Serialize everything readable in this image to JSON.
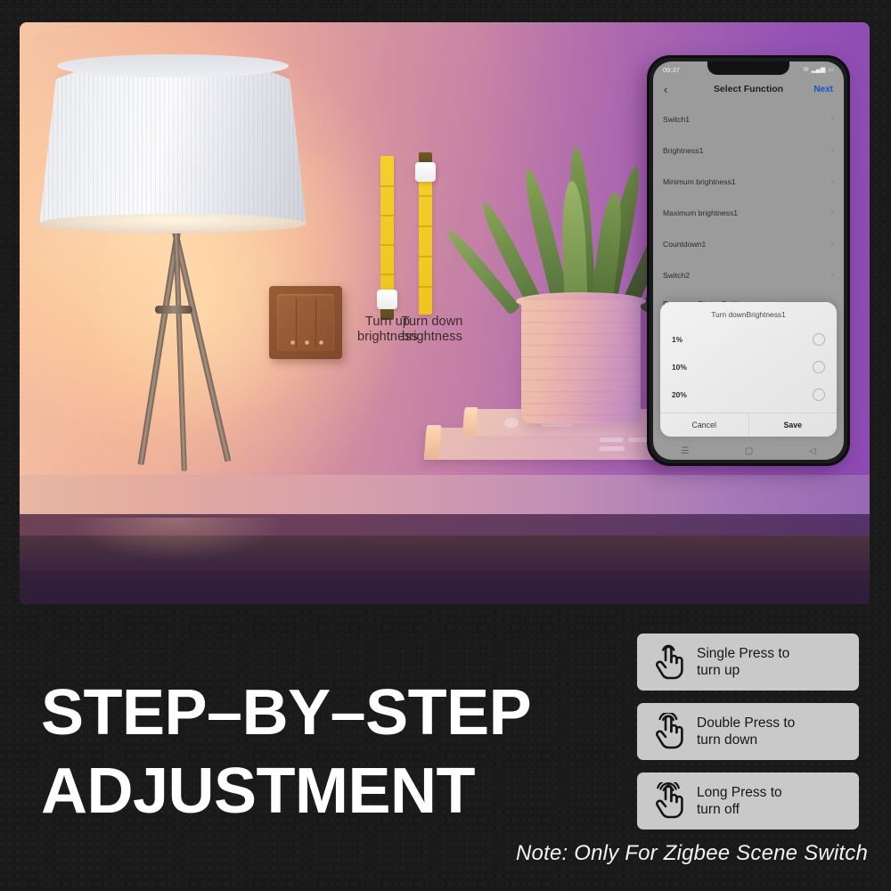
{
  "hero": {
    "slider_up": {
      "label": "Turn up\nbrightness"
    },
    "slider_down": {
      "label": "Turn down\nbrightness"
    }
  },
  "phone": {
    "status": {
      "time": "09:37",
      "mail_icon": "✉",
      "signal_icon": "▂▄▆",
      "battery_icon": "▭"
    },
    "navbar": {
      "back_icon": "‹",
      "title": "Select Function",
      "next_label": "Next"
    },
    "functions": [
      {
        "label": "Switch1",
        "chevron": "›"
      },
      {
        "label": "Brightness1",
        "chevron": "›"
      },
      {
        "label": "Minimum brightness1",
        "chevron": "›"
      },
      {
        "label": "Maximum brightness1",
        "chevron": "›"
      },
      {
        "label": "Countdown1",
        "chevron": "›"
      },
      {
        "label": "Switch2",
        "chevron": "›"
      },
      {
        "label": "Power-on Status Setting",
        "chevron": "›"
      }
    ],
    "modal": {
      "title": "Turn downBrightness1",
      "options": [
        {
          "label": "1%",
          "selected": false
        },
        {
          "label": "10%",
          "selected": false
        },
        {
          "label": "20%",
          "selected": false
        }
      ],
      "cancel_label": "Cancel",
      "save_label": "Save"
    },
    "navkeys": {
      "menu": "☰",
      "home": "▢",
      "back": "◁"
    }
  },
  "title": "STEP–BY–STEP\nADJUSTMENT",
  "cards": [
    {
      "icon": "single-tap-icon",
      "text": "Single Press to\nturn up"
    },
    {
      "icon": "double-tap-icon",
      "text": "Double Press to\nturn down"
    },
    {
      "icon": "long-press-icon",
      "text": "Long Press to\nturn off"
    }
  ],
  "note": "Note: Only For Zigbee Scene Switch",
  "colors": {
    "background": "#1a1a1a",
    "card_bg": "#c9c9c9",
    "accent_next": "#1155cc",
    "slider_yellow": "#f3c920",
    "switch_brown": "#8d5331"
  }
}
